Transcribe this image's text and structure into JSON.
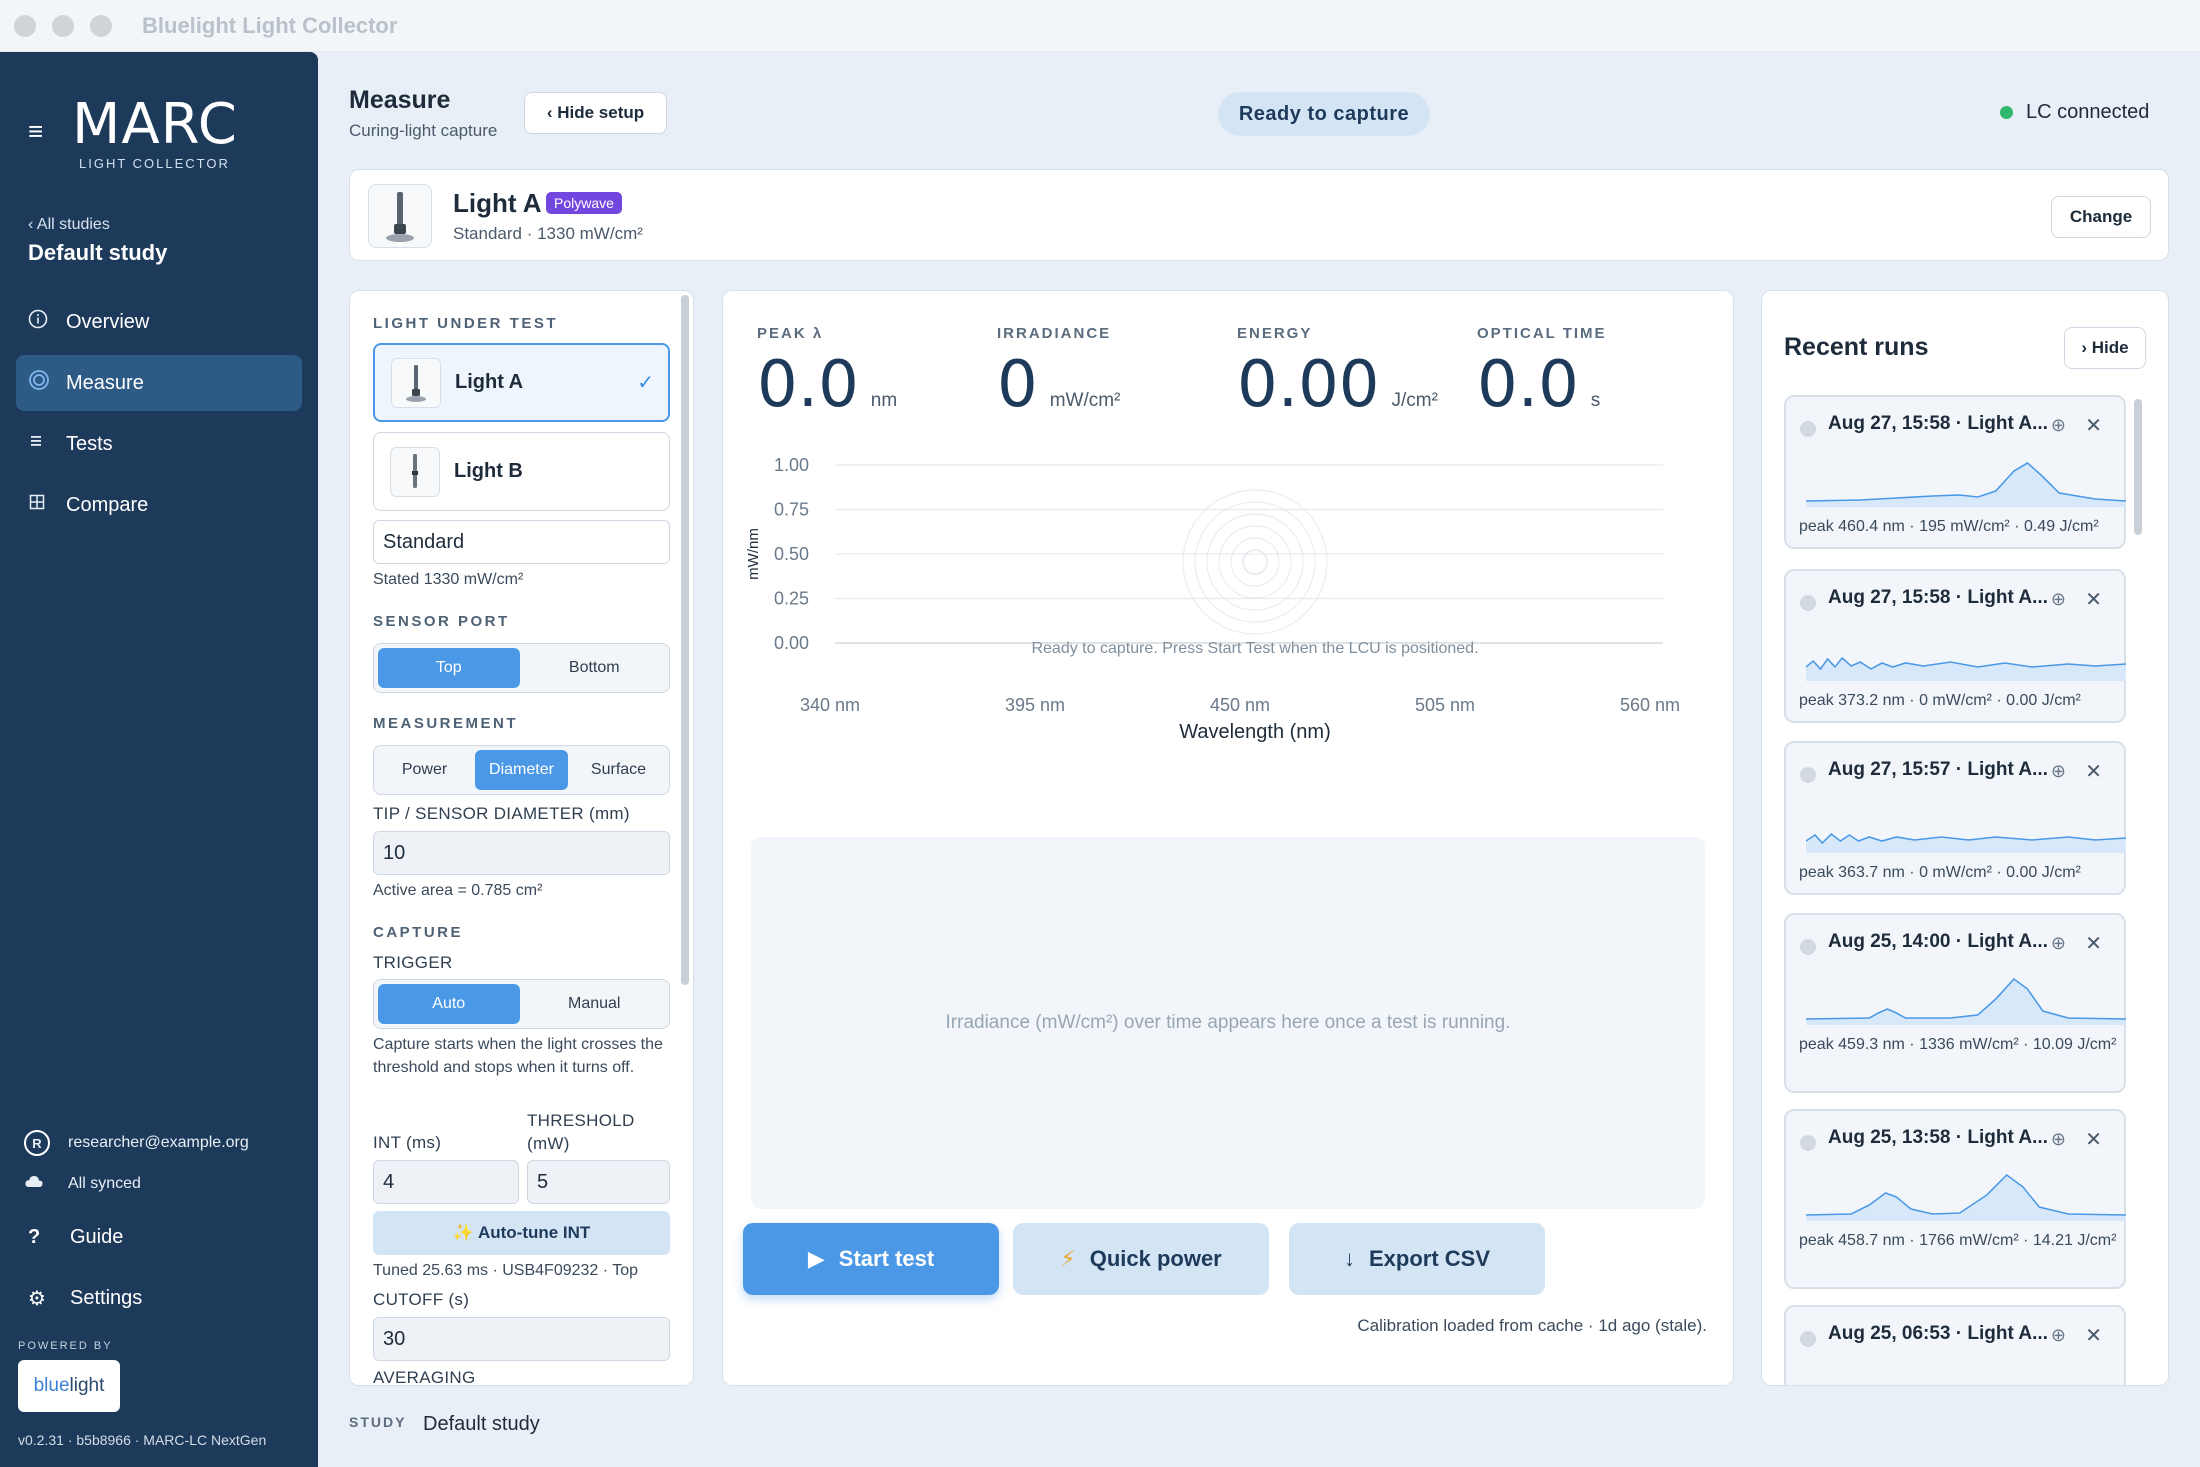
{
  "window": {
    "title": "Bluelight Light Collector"
  },
  "sidebar": {
    "logo": "MARC",
    "logo_sub": "LIGHT COLLECTOR",
    "back_link": "‹ All studies",
    "study": "Default study",
    "nav": [
      {
        "label": "Overview",
        "icon": "info-icon"
      },
      {
        "label": "Measure",
        "icon": "target-icon",
        "active": true
      },
      {
        "label": "Tests",
        "icon": "list-icon"
      },
      {
        "label": "Compare",
        "icon": "grid-icon"
      }
    ],
    "user": {
      "initial": "R",
      "email": "researcher@example.org"
    },
    "sync": "All synced",
    "guide": "Guide",
    "settings": "Settings",
    "powered_by": "POWERED BY",
    "brand": {
      "part1": "blue",
      "part2": "light"
    },
    "version": "v0.2.31 · b5b8966 · MARC-LC NextGen"
  },
  "header": {
    "title": "Measure",
    "subtitle": "Curing-light capture",
    "hide_setup": "‹ Hide setup",
    "status": "Ready to capture",
    "connection": "LC connected"
  },
  "light_card": {
    "name": "Light A",
    "badge": "Polywave",
    "desc": "Standard · 1330 mW/cm²",
    "change": "Change"
  },
  "setup": {
    "light_under_test": "LIGHT UNDER TEST",
    "lights": [
      {
        "name": "Light A",
        "check": "✓"
      },
      {
        "name": "Light B"
      }
    ],
    "mode_value": "Standard",
    "stated": "Stated 1330 mW/cm²",
    "sensor_port": "SENSOR PORT",
    "ports": [
      "Top",
      "Bottom"
    ],
    "measurement": "MEASUREMENT",
    "measurement_opts": [
      "Power",
      "Diameter",
      "Surface"
    ],
    "diameter_label": "TIP / SENSOR DIAMETER (mm)",
    "diameter_value": "10",
    "active_area": "Active area = 0.785 cm²",
    "capture": "CAPTURE",
    "trigger": "TRIGGER",
    "trigger_opts": [
      "Auto",
      "Manual"
    ],
    "trigger_hint": "Capture starts when the light crosses the threshold and stops when it turns off.",
    "int_label": "INT (ms)",
    "int_value": "4",
    "threshold_label": "THRESHOLD (mW)",
    "threshold_value": "5",
    "autotune": "✨ Auto-tune INT",
    "tuned": "Tuned 25.63 ms · USB4F09232 · Top",
    "cutoff_label": "CUTOFF (s)",
    "cutoff_value": "30",
    "averaging": "AVERAGING"
  },
  "metrics": [
    {
      "label": "PEAK λ",
      "value": "0.0",
      "unit": "nm"
    },
    {
      "label": "IRRADIANCE",
      "value": "0",
      "unit": "mW/cm²"
    },
    {
      "label": "ENERGY",
      "value": "0.00",
      "unit": "J/cm²"
    },
    {
      "label": "OPTICAL TIME",
      "value": "0.0",
      "unit": "s"
    }
  ],
  "chart_data": {
    "type": "line",
    "x": [
      340,
      395,
      450,
      505,
      560
    ],
    "x_tick_labels": [
      "340 nm",
      "395 nm",
      "450 nm",
      "505 nm",
      "560 nm"
    ],
    "y_tick_labels": [
      "1.00",
      "0.75",
      "0.50",
      "0.25",
      "0.00"
    ],
    "ylim": [
      0,
      1
    ],
    "xlabel": "Wavelength (nm)",
    "ylabel": "mW/nm",
    "message": "Ready to capture. Press Start Test when the LCU is positioned.",
    "series": []
  },
  "timeline_msg": "Irradiance (mW/cm²) over time appears here once a test is running.",
  "actions": {
    "start": "Start test",
    "quick": "Quick power",
    "export": "Export CSV"
  },
  "calibration": "Calibration loaded from cache · 1d ago (stale).",
  "recent": {
    "title": "Recent runs",
    "hide": "› Hide",
    "runs": [
      {
        "title": "Aug 27, 15:58 · Light A...",
        "meta": "peak 460.4 nm · 195 mW/cm² · 0.49 J/cm²"
      },
      {
        "title": "Aug 27, 15:58 · Light A...",
        "meta": "peak 373.2 nm · 0 mW/cm² · 0.00 J/cm²"
      },
      {
        "title": "Aug 27, 15:57 · Light A...",
        "meta": "peak 363.7 nm · 0 mW/cm² · 0.00 J/cm²"
      },
      {
        "title": "Aug 25, 14:00 · Light A...",
        "meta": "peak 459.3 nm · 1336 mW/cm² · 10.09 J/cm²"
      },
      {
        "title": "Aug 25, 13:58 · Light A...",
        "meta": "peak 458.7 nm · 1766 mW/cm² · 14.21 J/cm²"
      },
      {
        "title": "Aug 25, 06:53 · Light A...",
        "meta": ""
      }
    ]
  },
  "footer": {
    "label": "STUDY",
    "study": "Default study"
  },
  "colors": {
    "accent": "#4a98e6",
    "sidebar": "#1e3a5b",
    "badge": "#7446e0",
    "connected": "#2fb86b"
  }
}
